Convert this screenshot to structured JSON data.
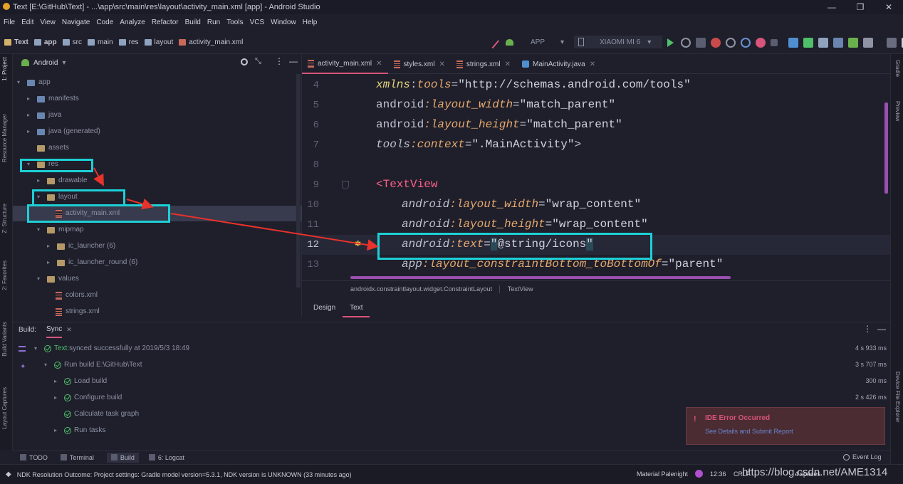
{
  "window": {
    "title": "Text [E:\\GitHub\\Text] - ...\\app\\src\\main\\res\\layout\\activity_main.xml [app] - Android Studio"
  },
  "menu": [
    "File",
    "Edit",
    "View",
    "Navigate",
    "Code",
    "Analyze",
    "Refactor",
    "Build",
    "Run",
    "Tools",
    "VCS",
    "Window",
    "Help"
  ],
  "breadcrumb": [
    "Text",
    "app",
    "src",
    "main",
    "res",
    "layout",
    "activity_main.xml"
  ],
  "toolbar": {
    "run_config": "APP",
    "device": "XIAOMI MI 6"
  },
  "left_tools": [
    "1: Project",
    "Resource Manager",
    "Z: Structure",
    "2: Favorites",
    "Build Variants",
    "Layout Captures"
  ],
  "right_tools": [
    "Gradle",
    "Preview",
    "Device File Explorer"
  ],
  "project": {
    "view": "Android",
    "tree": [
      {
        "label": "app",
        "level": 0,
        "icon": "app-folder",
        "expanded": true
      },
      {
        "label": "manifests",
        "level": 1,
        "icon": "folder-blue"
      },
      {
        "label": "java",
        "level": 1,
        "icon": "folder-blue"
      },
      {
        "label": "java (generated)",
        "level": 1,
        "icon": "folder-blue"
      },
      {
        "label": "assets",
        "level": 1,
        "icon": "folder"
      },
      {
        "label": "res",
        "level": 1,
        "icon": "folder",
        "expanded": true
      },
      {
        "label": "drawable",
        "level": 2,
        "icon": "folder"
      },
      {
        "label": "layout",
        "level": 2,
        "icon": "folder",
        "expanded": true
      },
      {
        "label": "activity_main.xml",
        "level": 3,
        "icon": "xml-file",
        "selected": true
      },
      {
        "label": "mipmap",
        "level": 2,
        "icon": "folder",
        "expanded": true
      },
      {
        "label": "ic_launcher (6)",
        "level": 3,
        "icon": "folder"
      },
      {
        "label": "ic_launcher_round (6)",
        "level": 3,
        "icon": "folder"
      },
      {
        "label": "values",
        "level": 2,
        "icon": "folder",
        "expanded": true
      },
      {
        "label": "colors.xml",
        "level": 3,
        "icon": "xml-file"
      },
      {
        "label": "strings.xml",
        "level": 3,
        "icon": "xml-file"
      }
    ]
  },
  "editor": {
    "tabs": [
      "activity_main.xml",
      "styles.xml",
      "strings.xml",
      "MainActivity.java"
    ],
    "line_numbers": [
      "4",
      "5",
      "6",
      "7",
      "8",
      "9",
      "10",
      "11",
      "12",
      "13"
    ],
    "lines": {
      "l4": {
        "ns": "xmlns",
        "attr": "tools",
        "val": "\"http://schemas.android.com/tools\""
      },
      "l5": {
        "ns": "android",
        "attr": "layout_width",
        "val": "\"match_parent\""
      },
      "l6": {
        "ns": "android",
        "attr": "layout_height",
        "val": "\"match_parent\""
      },
      "l7": {
        "ns": "tools",
        "attr": "context",
        "val": "\".MainActivity\"",
        "close": ">"
      },
      "l9": {
        "tag": "<TextView"
      },
      "l10": {
        "ns": "android",
        "attr": "layout_width",
        "val": "\"wrap_content\""
      },
      "l11": {
        "ns": "android",
        "attr": "layout_height",
        "val": "\"wrap_content\""
      },
      "l12": {
        "ns": "android",
        "attr": "text",
        "val_open": "\"",
        "val_body": "@string/icons",
        "val_close": "\""
      },
      "l13": {
        "ns": "app",
        "attr": "layout_constraintBottom_toBottomOf",
        "val": "\"parent\""
      }
    },
    "breadcrumb": [
      "androidx.constraintlayout.widget.ConstraintLayout",
      "TextView"
    ],
    "design_tabs": [
      "Design",
      "Text"
    ]
  },
  "build": {
    "label": "Build:",
    "tab": "Sync",
    "items": [
      {
        "text_bold": "Text:",
        "text": " synced successfully at 2019/5/3 18:49",
        "time": "4 s 933 ms",
        "level": 0
      },
      {
        "text_bold": "",
        "text": "Run build E:\\GitHub\\Text",
        "time": "3 s 707 ms",
        "level": 1
      },
      {
        "text_bold": "",
        "text": "Load build",
        "time": "300 ms",
        "level": 2
      },
      {
        "text_bold": "",
        "text": "Configure build",
        "time": "2 s 426 ms",
        "level": 2
      },
      {
        "text_bold": "",
        "text": "Calculate task graph",
        "time": "",
        "level": 2
      },
      {
        "text_bold": "",
        "text": "Run tasks",
        "time": "",
        "level": 2
      }
    ]
  },
  "bottom_tabs": [
    "TODO",
    "Terminal",
    "Build",
    "6: Logcat"
  ],
  "error_popup": {
    "title": "IDE Error Occurred",
    "link": "See Details and Submit Report"
  },
  "status": {
    "message": "NDK Resolution Outcome: Project settings: Gradle model version=5.3.1, NDK version is UNKNOWN (33 minutes ago)",
    "theme": "Material Palenight",
    "time": "12:36",
    "crlf": "CRLF",
    "spaces": "4 spaces",
    "event_log": "Event Log",
    "watermark": "https://blog.csdn.net/AME1314"
  },
  "colors": {
    "accent": "#d9547a",
    "highlight": "#1dd0d6",
    "arrow": "#e8322b"
  }
}
